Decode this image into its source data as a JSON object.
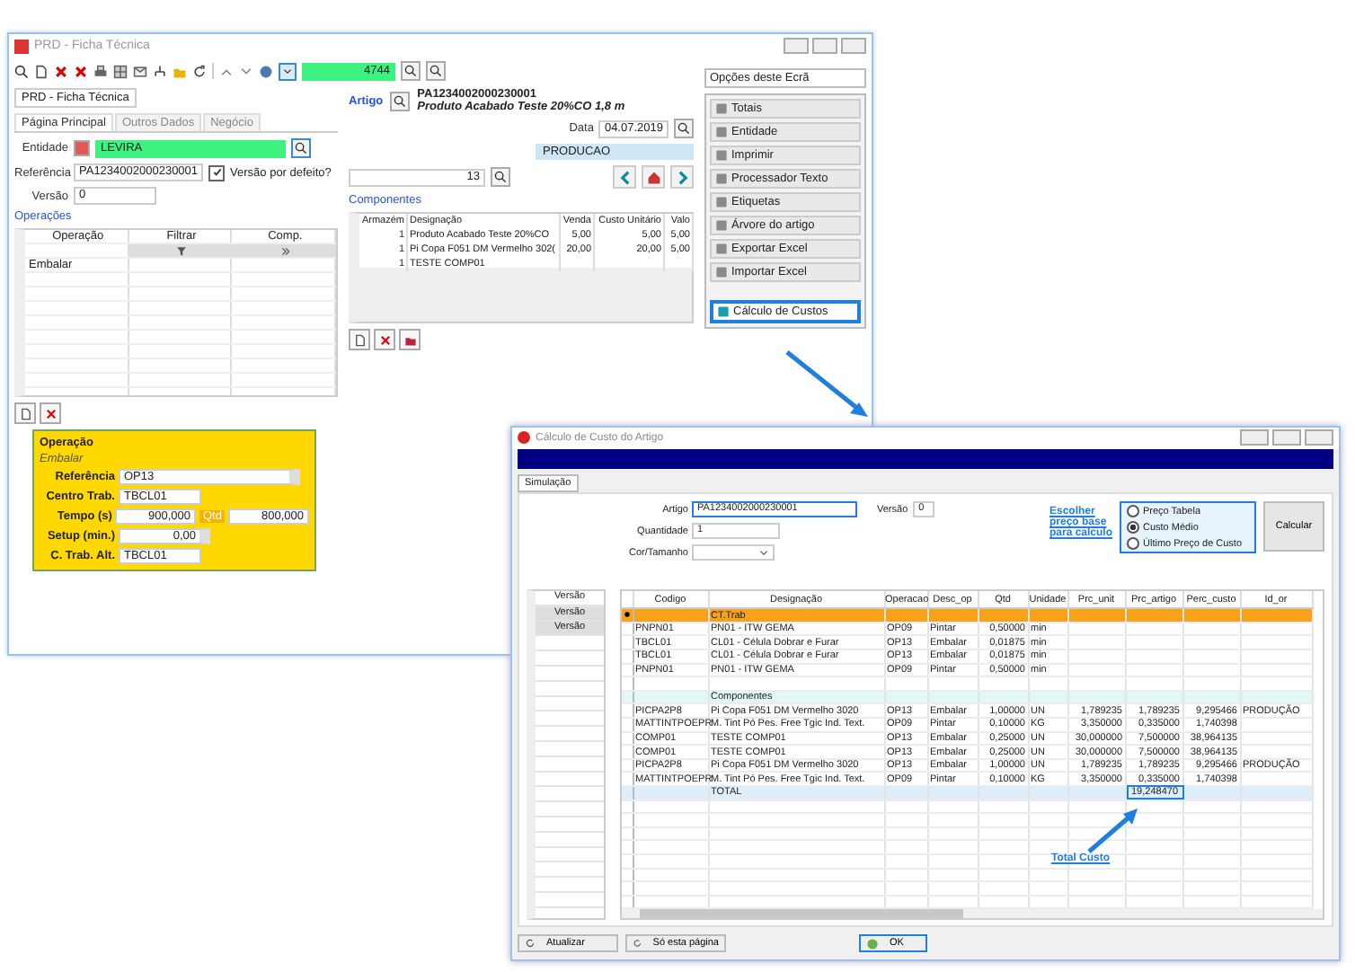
{
  "main_window": {
    "title": "PRD - Ficha Técnica",
    "toolbar": {
      "number_field": "4744",
      "count_field": "13"
    },
    "tab_header": "PRD - Ficha Técnica",
    "tabs": [
      {
        "label": "Página Principal",
        "selected": true
      },
      {
        "label": "Outros Dados",
        "selected": false
      },
      {
        "label": "Negócio",
        "selected": false
      }
    ],
    "form": {
      "entidade": {
        "label": "Entidade",
        "value": "LEVIRA"
      },
      "referencia": {
        "label": "Referência",
        "value": "PA1234002000230001"
      },
      "versao": {
        "label": "Versão",
        "value": "0"
      },
      "default_version": {
        "label": "Versão por defeito?",
        "checked": true
      }
    },
    "operacoes": {
      "title": "Operações",
      "columns": [
        "Operação",
        "Filtrar",
        "Comp."
      ],
      "rows": [
        "Embalar"
      ]
    },
    "operation_panel": {
      "title": "Operação",
      "name": "Embalar",
      "referencia": {
        "label": "Referência",
        "value": "OP13"
      },
      "centro": {
        "label": "Centro Trab.",
        "value": "TBCL01"
      },
      "tempo": {
        "label": "Tempo (s)",
        "value": "900,000"
      },
      "qtd": {
        "label": "Qtd",
        "value": "800,000"
      },
      "setup": {
        "label": "Setup (min.)",
        "value": "0,00"
      },
      "alt": {
        "label": "C. Trab. Alt.",
        "value": "TBCL01"
      }
    },
    "artigo": {
      "label": "Artigo",
      "code": "PA1234002000230001",
      "description": "Produto Acabado Teste 20%CO 1,8 m"
    },
    "data": {
      "label": "Data",
      "value": "04.07.2019"
    },
    "status_field": "PRODUCAO",
    "componentes": {
      "title": "Componentes",
      "columns": [
        "Armazém",
        "Designação",
        "Venda",
        "Custo Unitário",
        "Valo"
      ],
      "rows": [
        [
          "1",
          "Produto Acabado Teste 20%CO",
          "5,00",
          "5,00",
          "5,00"
        ],
        [
          "1",
          "Pi Copa F051 DM Vermelho 302(",
          "20,00",
          "20,00",
          "5,00"
        ],
        [
          "1",
          "TESTE COMP01",
          "",
          "",
          ""
        ]
      ]
    },
    "options": {
      "dropdown": "Opções deste Ecrã",
      "items": [
        {
          "label": "Totais",
          "selected": false
        },
        {
          "label": "Entidade",
          "selected": false
        },
        {
          "label": "Imprimir",
          "selected": false
        },
        {
          "label": "Processador Texto",
          "selected": false
        },
        {
          "label": "Etiquetas",
          "selected": false
        },
        {
          "label": "Árvore do artigo",
          "selected": false
        },
        {
          "label": "Exportar Excel",
          "selected": false
        },
        {
          "label": "Importar Excel",
          "selected": false
        },
        {
          "label": "Cálculo de Custos",
          "selected": true
        }
      ]
    }
  },
  "dialog": {
    "title": "Cálculo de Custo do Artigo",
    "tab": "Simulação",
    "artigo": {
      "label": "Artigo",
      "value": "PA1234002000230001"
    },
    "versao": {
      "label": "Versão",
      "value": "0"
    },
    "quantidade": {
      "label": "Quantidade",
      "value": "1"
    },
    "cor_tamanho": {
      "label": "Cor/Tamanho"
    },
    "price_hint": "Escolher preço base para calculo",
    "price_options": [
      {
        "label": "Preço Tabela",
        "selected": false
      },
      {
        "label": "Custo Médio",
        "selected": true
      },
      {
        "label": "Último Preço de Custo",
        "selected": false
      }
    ],
    "calc_button": "Calcular",
    "versions": {
      "column": "Versão",
      "rows": [
        "Versão",
        "Versão"
      ]
    },
    "table": {
      "columns": [
        "Codigo",
        "Designação",
        "Operacao",
        "Desc_op",
        "Qtd",
        "Unidade",
        "Prc_unit",
        "Prc_artigo",
        "Perc_custo",
        "Id_or"
      ],
      "rows": [
        {
          "kind": "section",
          "selected": true,
          "cells": [
            "",
            "CT.Trab",
            "",
            "",
            "",
            "",
            "",
            "",
            "",
            ""
          ]
        },
        {
          "kind": "data",
          "selected": false,
          "cells": [
            "PNPN01",
            "PN01 - ITW GEMA",
            "OP09",
            "Pintar",
            "0,50000",
            "min",
            "",
            "",
            "",
            ""
          ]
        },
        {
          "kind": "data",
          "selected": false,
          "cells": [
            "TBCL01",
            "CL01 - Célula Dobrar e Furar",
            "OP13",
            "Embalar",
            "0,01875",
            "min",
            "",
            "",
            "",
            ""
          ]
        },
        {
          "kind": "data",
          "selected": false,
          "cells": [
            "TBCL01",
            "CL01 - Célula Dobrar e Furar",
            "OP13",
            "Embalar",
            "0,01875",
            "min",
            "",
            "",
            "",
            ""
          ]
        },
        {
          "kind": "data",
          "selected": false,
          "cells": [
            "PNPN01",
            "PN01 - ITW GEMA",
            "OP09",
            "Pintar",
            "0,50000",
            "min",
            "",
            "",
            "",
            ""
          ]
        },
        {
          "kind": "data",
          "selected": false,
          "cells": [
            "",
            "",
            "",
            "",
            "",
            "",
            "",
            "",
            "",
            ""
          ]
        },
        {
          "kind": "section",
          "selected": false,
          "cells": [
            "",
            "Componentes",
            "",
            "",
            "",
            "",
            "",
            "",
            "",
            ""
          ]
        },
        {
          "kind": "data",
          "selected": false,
          "cells": [
            "PICPA2P8",
            "Pi Copa F051 DM Vermelho 3020",
            "OP13",
            "Embalar",
            "1,00000",
            "UN",
            "1,789235",
            "1,789235",
            "9,295466",
            "PRODUÇÃO"
          ]
        },
        {
          "kind": "data",
          "selected": false,
          "cells": [
            "MATTINTPOEPR",
            "M. Tint Pó Pes. Free Tgic Ind. Text.",
            "OP09",
            "Pintar",
            "0,10000",
            "KG",
            "3,350000",
            "0,335000",
            "1,740398",
            ""
          ]
        },
        {
          "kind": "data",
          "selected": false,
          "cells": [
            "COMP01",
            "TESTE COMP01",
            "OP13",
            "Embalar",
            "0,25000",
            "UN",
            "30,000000",
            "7,500000",
            "38,964135",
            ""
          ]
        },
        {
          "kind": "data",
          "selected": false,
          "cells": [
            "COMP01",
            "TESTE COMP01",
            "OP13",
            "Embalar",
            "0,25000",
            "UN",
            "30,000000",
            "7,500000",
            "38,964135",
            ""
          ]
        },
        {
          "kind": "data",
          "selected": false,
          "cells": [
            "PICPA2P8",
            "Pi Copa F051 DM Vermelho 3020",
            "OP13",
            "Embalar",
            "1,00000",
            "UN",
            "1,789235",
            "1,789235",
            "9,295466",
            "PRODUÇÃO"
          ]
        },
        {
          "kind": "data",
          "selected": false,
          "cells": [
            "MATTINTPOEPR",
            "M. Tint Pó Pes. Free Tgic Ind. Text.",
            "OP09",
            "Pintar",
            "0,10000",
            "KG",
            "3,350000",
            "0,335000",
            "1,740398",
            ""
          ]
        },
        {
          "kind": "total",
          "selected": false,
          "cells": [
            "",
            "TOTAL",
            "",
            "",
            "",
            "",
            "",
            "19,248470",
            "",
            ""
          ]
        }
      ]
    },
    "total_hint": "Total Custo",
    "buttons": [
      "Atualizar",
      "Só esta página"
    ],
    "ok_button": "OK"
  }
}
